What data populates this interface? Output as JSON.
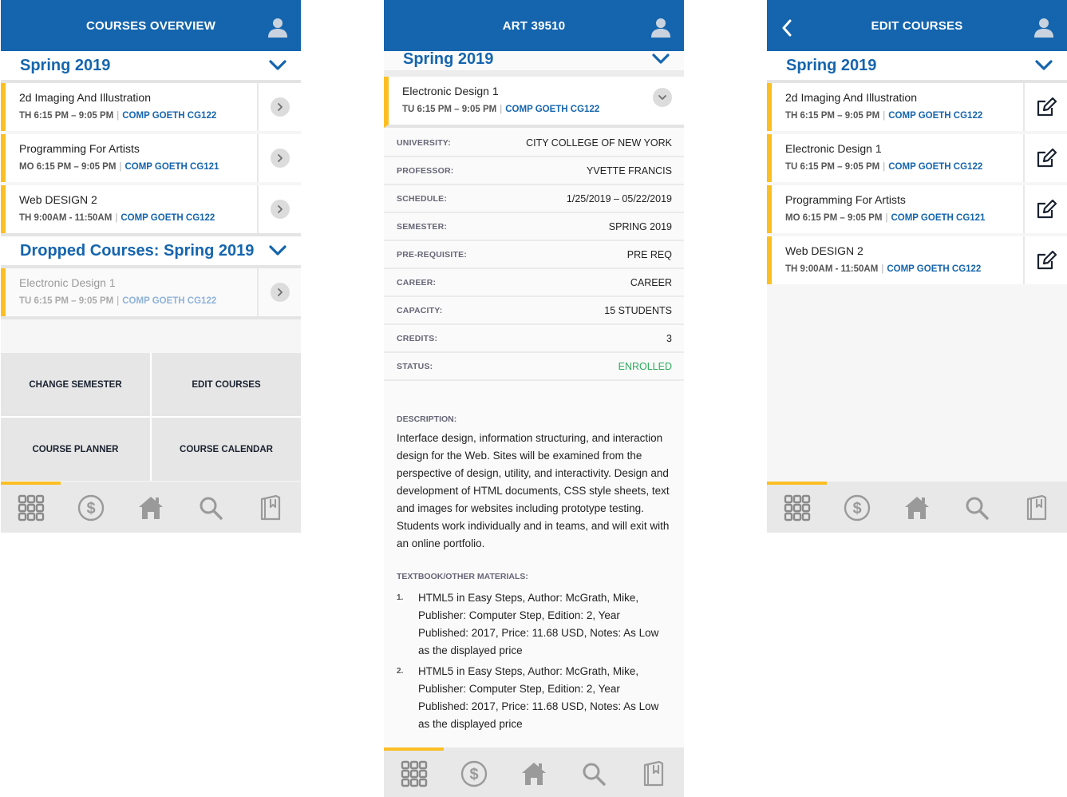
{
  "screen1": {
    "title": "COURSES OVERVIEW",
    "semester": "Spring 2019",
    "courses": [
      {
        "name": "2d Imaging And Illustration",
        "time": "TH 6:15 PM – 9:05 PM",
        "room": "COMP GOETH CG122"
      },
      {
        "name": "Programming For Artists",
        "time": "MO 6:15 PM – 9:05 PM",
        "room": "COMP GOETH CG121"
      },
      {
        "name": "Web DESIGN 2",
        "time": "TH 9:00AM - 11:50AM",
        "room": "COMP GOETH CG122"
      }
    ],
    "dropped_title": "Dropped Courses: Spring 2019",
    "dropped": [
      {
        "name": "Electronic Design 1",
        "time": "TU 6:15 PM – 9:05 PM",
        "room": "COMP GOETH CG122"
      }
    ],
    "buttons": [
      "CHANGE SEMESTER",
      "EDIT COURSES",
      "COURSE PLANNER",
      "COURSE CALENDAR"
    ]
  },
  "screen2": {
    "title": "ART 39510",
    "semester": "Spring 2019",
    "course": {
      "name": "Electronic Design 1",
      "time": "TU 6:15 PM – 9:05 PM",
      "room": "COMP GOETH CG122"
    },
    "fields": [
      {
        "label": "UNIVERSITY:",
        "value": "CITY COLLEGE OF NEW YORK"
      },
      {
        "label": "PROFESSOR:",
        "value": "YVETTE FRANCIS"
      },
      {
        "label": "SCHEDULE:",
        "value": "1/25/2019 – 05/22/2019"
      },
      {
        "label": "SEMESTER:",
        "value": "SPRING 2019"
      },
      {
        "label": "PRE-REQUISITE:",
        "value": "PRE REQ"
      },
      {
        "label": "CAREER:",
        "value": "CAREER"
      },
      {
        "label": "CAPACITY:",
        "value": "15 STUDENTS"
      },
      {
        "label": "CREDITS:",
        "value": "3"
      },
      {
        "label": "STATUS:",
        "value": "ENROLLED"
      }
    ],
    "description_label": "DESCRIPTION:",
    "description": "Interface design, information structuring, and interaction design for the Web. Sites will be examined from the perspective of design, utility, and interactivity. Design and development of HTML documents, CSS style sheets, text and images for websites including prototype testing. Students work individually and in teams, and will exit with an online portfolio.",
    "materials_label": "TEXTBOOK/OTHER MATERIALS:",
    "materials": [
      {
        "num": "1.",
        "text": "HTML5 in Easy Steps, Author: McGrath, Mike, Publisher: Computer Step, Edition: 2, Year Published: 2017, Price: 11.68 USD, Notes: As Low as the displayed price"
      },
      {
        "num": "2.",
        "text": "HTML5 in Easy Steps, Author: McGrath, Mike, Publisher: Computer Step, Edition: 2, Year Published: 2017, Price: 11.68 USD, Notes: As Low as the displayed price"
      }
    ]
  },
  "screen3": {
    "title": "EDIT COURSES",
    "semester": "Spring 2019",
    "courses": [
      {
        "name": "2d Imaging And Illustration",
        "time": "TH 6:15 PM – 9:05 PM",
        "room": "COMP GOETH CG122"
      },
      {
        "name": "Electronic Design 1",
        "time": "TU 6:15 PM – 9:05 PM",
        "room": "COMP GOETH CG122"
      },
      {
        "name": "Programming For Artists",
        "time": "MO 6:15 PM – 9:05 PM",
        "room": "COMP GOETH CG121"
      },
      {
        "name": "Web DESIGN 2",
        "time": "TH 9:00AM - 11:50AM",
        "room": "COMP GOETH CG122"
      }
    ]
  },
  "tabbar": {
    "icons": [
      "grid-icon",
      "dollar-icon",
      "home-icon",
      "search-icon",
      "book-icon"
    ],
    "active_index": 0
  },
  "colors": {
    "brand_blue": "#1565ae",
    "accent_yellow": "#fbbf24",
    "status_green": "#2eaa5c"
  }
}
